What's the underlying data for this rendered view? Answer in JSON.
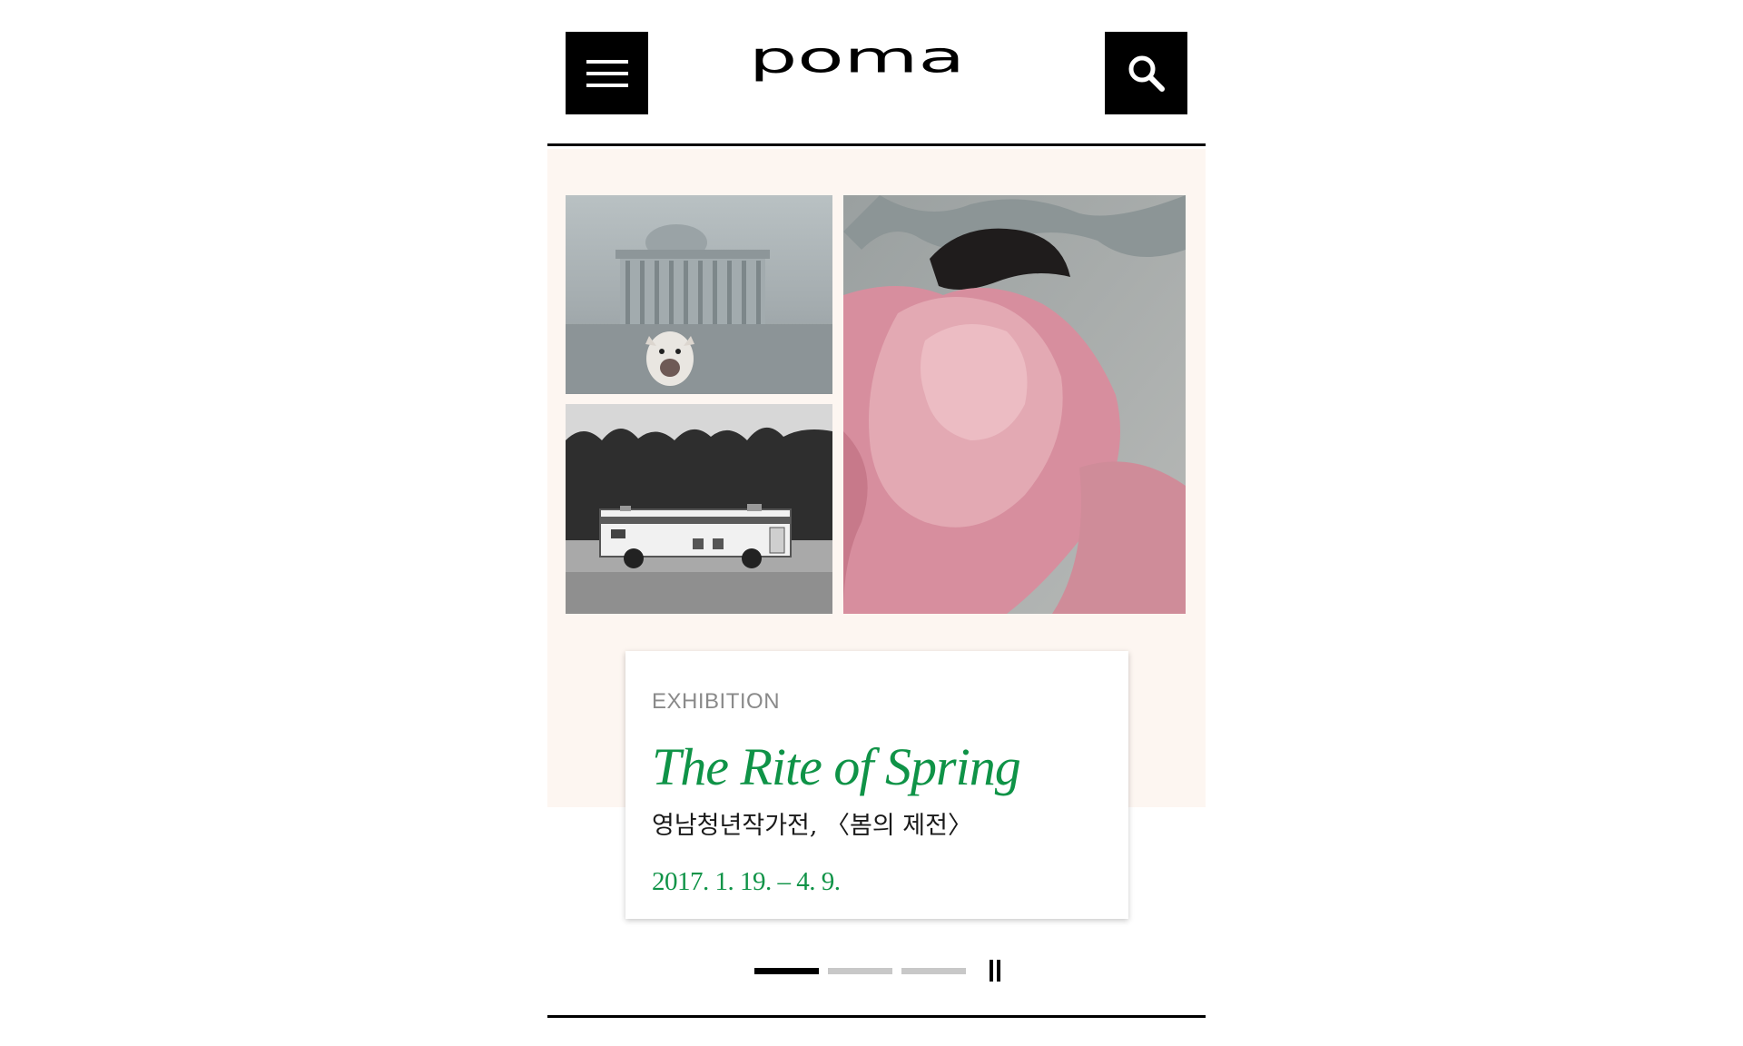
{
  "header": {
    "logo_text": "poma",
    "menu_icon": "hamburger-icon",
    "search_icon": "search-icon"
  },
  "hero": {
    "background_color": "#fdf6f1",
    "images": [
      {
        "name": "national-assembly-bulldog-artwork"
      },
      {
        "name": "white-bus-artwork"
      },
      {
        "name": "pink-figure-painting"
      }
    ]
  },
  "card": {
    "category": "EXHIBITION",
    "title": "The Rite of Spring",
    "subtitle": "영남청년작가전, 〈봄의 제전〉",
    "date": "2017. 1. 19. – 4. 9.",
    "accent_color": "#0f9347"
  },
  "pager": {
    "total_slides": 3,
    "current_slide": 1,
    "pause_icon": "pause-icon"
  }
}
